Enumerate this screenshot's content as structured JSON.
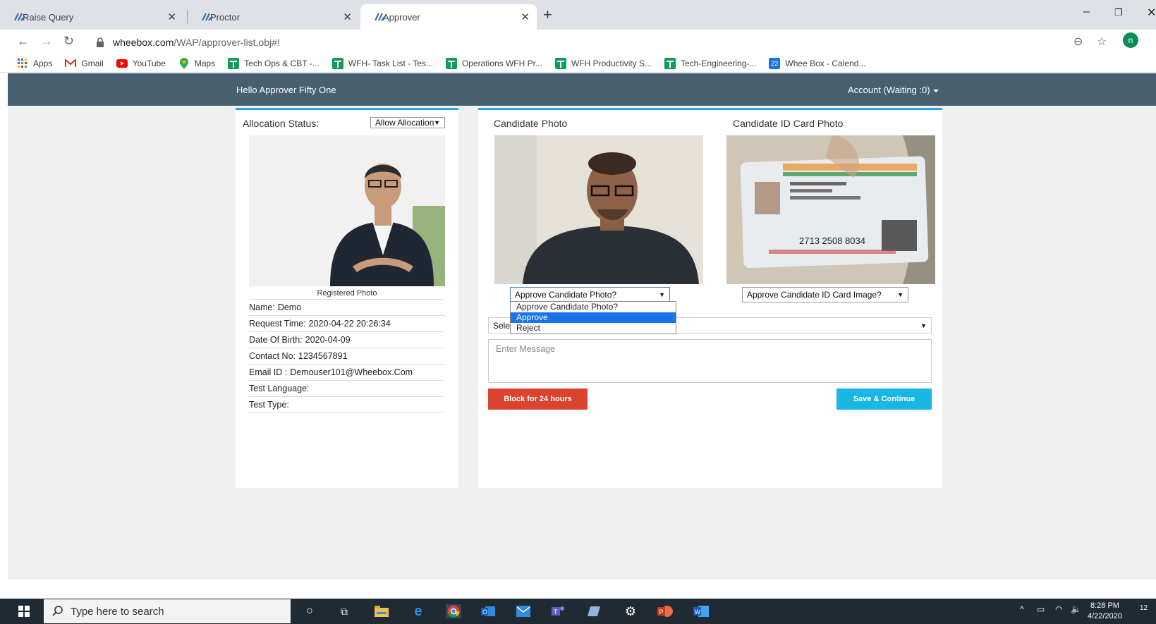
{
  "browser": {
    "tabs": [
      {
        "label": "Raise Query",
        "active": false
      },
      {
        "label": "Proctor",
        "active": false
      },
      {
        "label": "Approver",
        "active": true
      }
    ],
    "url_host": "wheebox.com",
    "url_path": "/WAP/approver-list.obj#!",
    "profile_initial": "n",
    "bookmarks": [
      {
        "label": "Apps",
        "icon": "apps-grid-icon"
      },
      {
        "label": "Gmail",
        "icon": "gmail-icon"
      },
      {
        "label": "YouTube",
        "icon": "youtube-icon"
      },
      {
        "label": "Maps",
        "icon": "maps-icon"
      },
      {
        "label": "Tech Ops & CBT -...",
        "icon": "sheets-icon"
      },
      {
        "label": "WFH- Task List - Tes...",
        "icon": "sheets-icon"
      },
      {
        "label": "Operations WFH Pr...",
        "icon": "sheets-icon"
      },
      {
        "label": "WFH Productivity S...",
        "icon": "sheets-icon"
      },
      {
        "label": "Tech-Engineering-...",
        "icon": "sheets-icon"
      },
      {
        "label": "Whee Box - Calend...",
        "icon": "calendar-icon",
        "badge": "22"
      }
    ]
  },
  "header": {
    "greeting": "Hello Approver Fifty One",
    "account": "Account (Waiting :0)"
  },
  "left_panel": {
    "allocation_label": "Allocation Status:",
    "allocation_select": "Allow Allocation",
    "photo_caption": "Registered Photo",
    "info": [
      {
        "label": "Name:",
        "value": "Demo"
      },
      {
        "label": "Request Time:",
        "value": "2020-04-22 20:26:34"
      },
      {
        "label": "Date Of Birth:",
        "value": "2020-04-09"
      },
      {
        "label": "Contact No:",
        "value": "1234567891"
      },
      {
        "label": "Email ID :",
        "value": "Demouser101@Wheebox.Com"
      },
      {
        "label": "Test Language:",
        "value": ""
      },
      {
        "label": "Test Type:",
        "value": ""
      }
    ]
  },
  "right_panel": {
    "candidate_photo_title": "Candidate Photo",
    "id_photo_title": "Candidate ID Card Photo",
    "id_card_number": "2713 2508 8034",
    "candidate_select": "Approve Candidate Photo?",
    "candidate_options": [
      "Approve Candidate Photo?",
      "Approve",
      "Reject"
    ],
    "candidate_selected_index": 1,
    "id_select": "Approve Candidate ID Card Image?",
    "reason_select_partial": "Sele",
    "message_placeholder": "Enter Message",
    "block_button": "Block for 24 hours",
    "save_button": "Save & Continue"
  },
  "taskbar": {
    "search_placeholder": "Type here to search",
    "time": "8:28 PM",
    "date": "4/22/2020",
    "notification_count": "12"
  }
}
